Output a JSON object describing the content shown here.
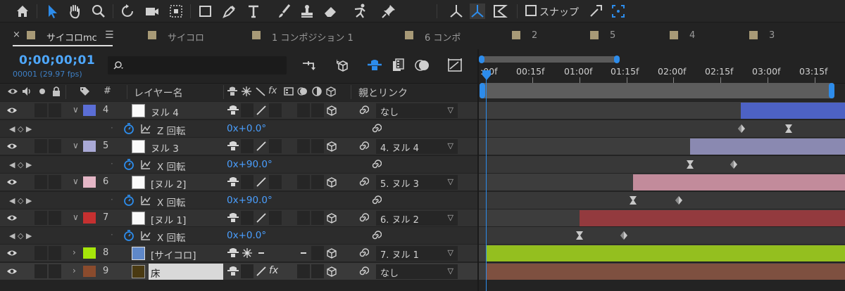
{
  "toolbar": {
    "tools": [
      "home-icon",
      "selection-tool-icon",
      "hand-tool-icon",
      "zoom-tool-icon",
      "rotate-tool-icon",
      "camera-tool-icon",
      "pan-behind-tool-icon",
      "rectangle-tool-icon",
      "pen-tool-icon",
      "type-tool-icon",
      "brush-tool-icon",
      "clone-stamp-tool-icon",
      "eraser-tool-icon",
      "puppet-tool-icon",
      "pin-tool-icon",
      "local-axis-icon",
      "world-axis-icon",
      "view-axis-icon",
      "snap-magnet-icon",
      "snap-target-icon"
    ],
    "snap_label": "スナップ"
  },
  "tabs": {
    "close": "×",
    "menu": "☰",
    "items": [
      {
        "label": "サイコロmc",
        "active": true
      },
      {
        "label": "サイコロ"
      },
      {
        "label": "1 コンポジション 1"
      },
      {
        "label": "6 コンポ"
      },
      {
        "label": "2"
      },
      {
        "label": "5"
      },
      {
        "label": "4"
      },
      {
        "label": "3"
      }
    ],
    "swatch_color": "#a89a77"
  },
  "controls": {
    "timecode": "0;00;00;01",
    "frame_info": "00001 (29.97 fps)",
    "search_placeholder": ""
  },
  "ruler": {
    "labels": [
      ":00f",
      "00:15f",
      "01:00f",
      "01:15f",
      "02:00f",
      "02:15f",
      "03:00f",
      "03:15f"
    ]
  },
  "columns": {
    "hash": "#",
    "layer_name": "レイヤー名",
    "parent_link": "親とリンク"
  },
  "layers": [
    {
      "num": "4",
      "name": "ヌル 4",
      "color": "#5b6ed6",
      "parent": "なし",
      "bar_color": "#4d62c4",
      "prop": "Z 回転",
      "prop_value": "0x+0.0°"
    },
    {
      "num": "5",
      "name": "ヌル 3",
      "color": "#a9a9d6",
      "parent": "4. ヌル 4",
      "bar_color": "#8a89b1",
      "prop": "X 回転",
      "prop_value": "0x+90.0°"
    },
    {
      "num": "6",
      "name": "[ヌル 2]",
      "color": "#e4b6c6",
      "parent": "5. ヌル 3",
      "bar_color": "#c28b9b",
      "prop": "X 回転",
      "prop_value": "0x+90.0°"
    },
    {
      "num": "7",
      "name": "[ヌル 1]",
      "color": "#c53030",
      "parent": "6. ヌル 2",
      "bar_color": "#933a3e",
      "prop": "X 回転",
      "prop_value": "0x+0.0°"
    },
    {
      "num": "8",
      "name": "[サイコロ]",
      "color": "#a6e60a",
      "parent": "7. ヌル 1",
      "bar_color": "#94bf1f"
    },
    {
      "num": "9",
      "name": "床",
      "color": "#8a4b2d",
      "parent": "なし",
      "bar_color": "#7e5040"
    }
  ]
}
